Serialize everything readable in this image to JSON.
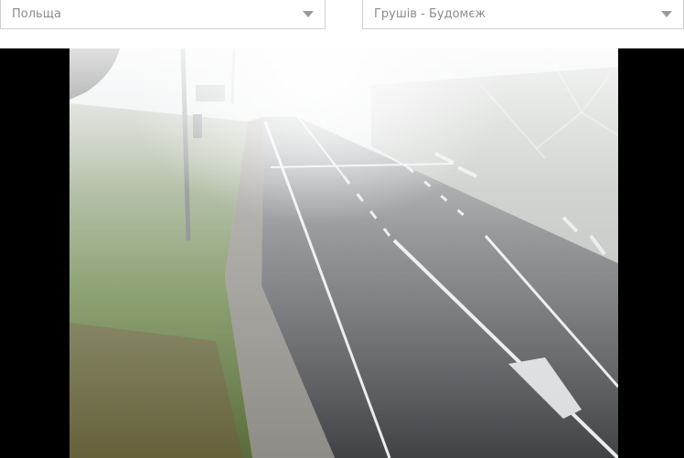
{
  "selectors": {
    "country": {
      "value": "Польща"
    },
    "crossing": {
      "value": "Грушів - Будомєж"
    }
  },
  "camera": {
    "subject": "foggy road camera view"
  },
  "colors": {
    "placeholder_text": "#8c8c8c",
    "border": "#cfcfcf",
    "player_bg": "#000000"
  }
}
